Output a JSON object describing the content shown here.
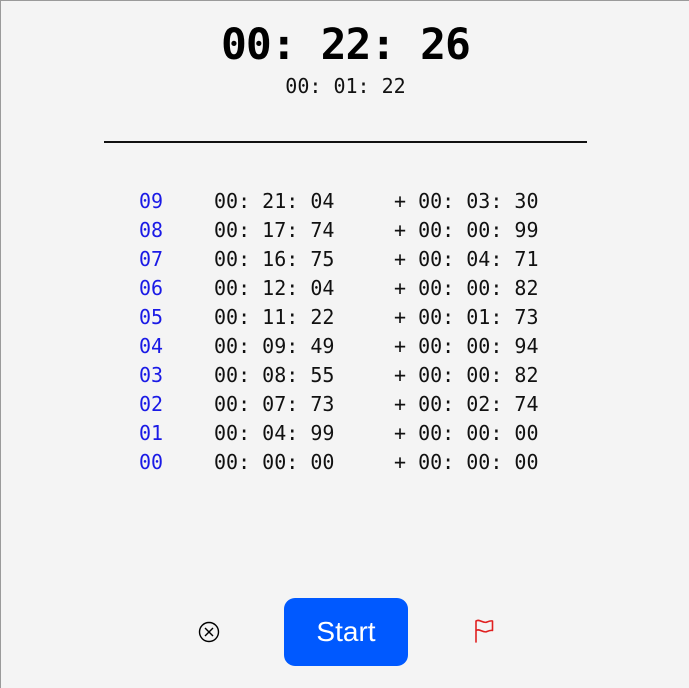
{
  "stopwatch": {
    "total_time": "00: 22: 26",
    "current_lap_time": "00: 01: 22"
  },
  "laps": [
    {
      "number": "09",
      "total": "00: 21: 04",
      "diff": "+ 00: 03: 30"
    },
    {
      "number": "08",
      "total": "00: 17: 74",
      "diff": "+ 00: 00: 99"
    },
    {
      "number": "07",
      "total": "00: 16: 75",
      "diff": "+ 00: 04: 71"
    },
    {
      "number": "06",
      "total": "00: 12: 04",
      "diff": "+ 00: 00: 82"
    },
    {
      "number": "05",
      "total": "00: 11: 22",
      "diff": "+ 00: 01: 73"
    },
    {
      "number": "04",
      "total": "00: 09: 49",
      "diff": "+ 00: 00: 94"
    },
    {
      "number": "03",
      "total": "00: 08: 55",
      "diff": "+ 00: 00: 82"
    },
    {
      "number": "02",
      "total": "00: 07: 73",
      "diff": "+ 00: 02: 74"
    },
    {
      "number": "01",
      "total": "00: 04: 99",
      "diff": "+ 00: 00: 00"
    },
    {
      "number": "00",
      "total": "00: 00: 00",
      "diff": "+ 00: 00: 00"
    }
  ],
  "controls": {
    "reset_icon": "circle-x-icon",
    "start_label": "Start",
    "start_color": "#0059ff",
    "flag_icon": "flag-icon",
    "flag_color": "#e02020"
  },
  "colors": {
    "lap_number": "#1a1ae6",
    "background": "#f4f4f4"
  }
}
